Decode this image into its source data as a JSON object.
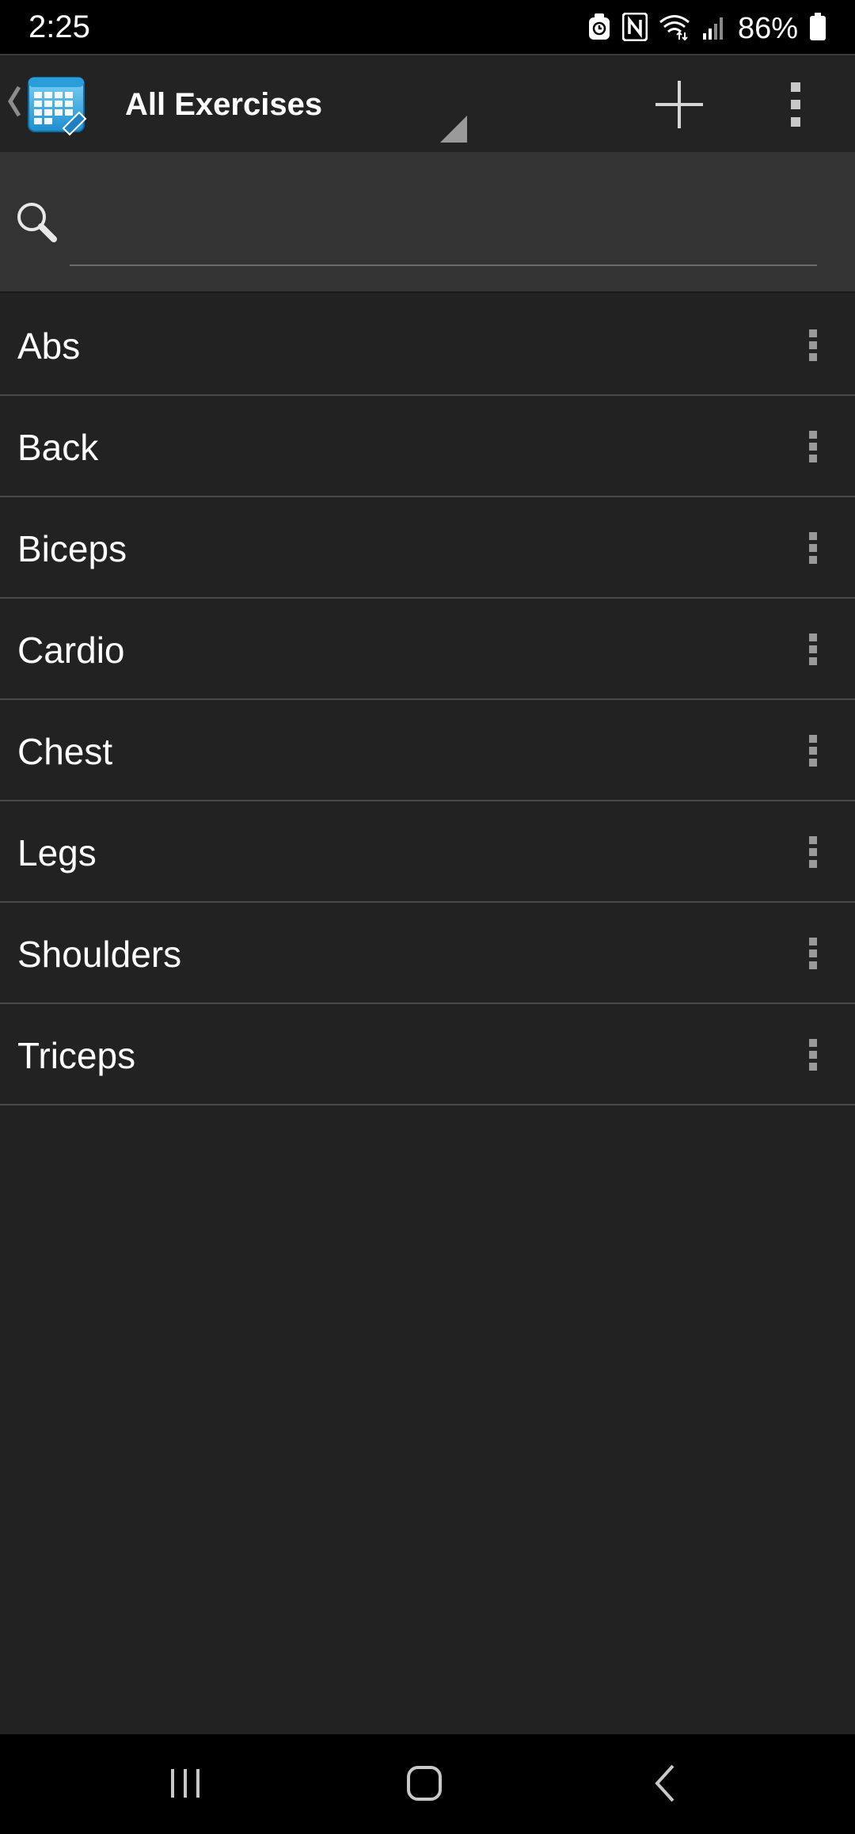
{
  "status_bar": {
    "time": "2:25",
    "battery": "86%",
    "icons": [
      "alarm-icon",
      "nfc-icon",
      "wifi-icon",
      "signal-icon",
      "battery-icon"
    ]
  },
  "action_bar": {
    "title": "All Exercises",
    "icons": [
      "up-chevron-icon",
      "app-calendar-icon",
      "spinner-triangle-icon",
      "add-icon",
      "overflow-menu-icon"
    ]
  },
  "search": {
    "value": "",
    "placeholder": ""
  },
  "exercises": {
    "items": [
      {
        "label": "Abs"
      },
      {
        "label": "Back"
      },
      {
        "label": "Biceps"
      },
      {
        "label": "Cardio"
      },
      {
        "label": "Chest"
      },
      {
        "label": "Legs"
      },
      {
        "label": "Shoulders"
      },
      {
        "label": "Triceps"
      }
    ]
  },
  "nav_bar": {
    "icons": [
      "recents-icon",
      "home-icon",
      "back-icon"
    ]
  },
  "colors": {
    "background": "#222222",
    "status_bar": "#000000",
    "search_area": "#333333",
    "divider": "#4a4a4a",
    "text": "#ffffff",
    "icon_grey": "#9a9a9a"
  }
}
